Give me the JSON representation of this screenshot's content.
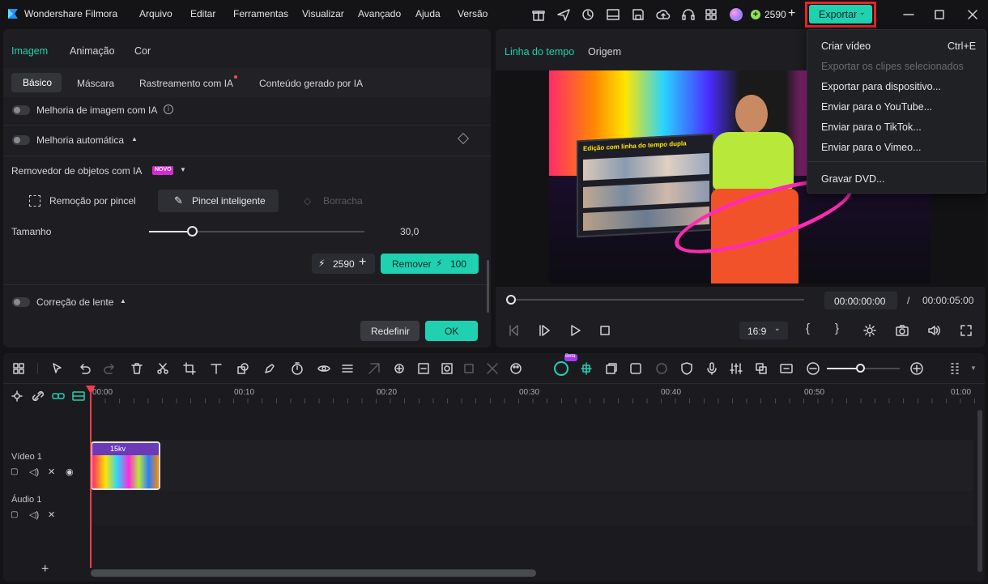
{
  "app": {
    "title": "Wondershare Filmora"
  },
  "menu": [
    "Arquivo",
    "Editar",
    "Ferramentas",
    "Visualizar",
    "Avançado",
    "Ajuda",
    "Versão"
  ],
  "credits": "2590",
  "export_button": "Exportar",
  "export_menu": {
    "items": [
      {
        "label": "Criar vídeo",
        "shortcut": "Ctrl+E",
        "enabled": true
      },
      {
        "label": "Exportar os clipes selecionados",
        "shortcut": "",
        "enabled": false
      },
      {
        "label": "Exportar para dispositivo...",
        "shortcut": "",
        "enabled": true
      },
      {
        "label": "Enviar para o YouTube...",
        "shortcut": "",
        "enabled": true
      },
      {
        "label": "Enviar para o TikTok...",
        "shortcut": "",
        "enabled": true
      },
      {
        "label": "Enviar para o Vimeo...",
        "shortcut": "",
        "enabled": true
      },
      {
        "label": "Gravar DVD...",
        "shortcut": "",
        "enabled": true
      }
    ]
  },
  "left_panel": {
    "tabs": [
      "Imagem",
      "Animação",
      "Cor"
    ],
    "active_tab": "Imagem",
    "subtabs": [
      "Básico",
      "Máscara",
      "Rastreamento com IA",
      "Conteúdo gerado por IA"
    ],
    "active_subtab": "Básico",
    "ai_enhance": "Melhoria de imagem com IA",
    "auto_enhance": "Melhoria automática",
    "object_remover": "Removedor de objetos com IA",
    "new_badge": "NOVO",
    "brush_remove": "Remoção por pincel",
    "smart_brush": "Pincel inteligente",
    "eraser": "Borracha",
    "size_label": "Tamanho",
    "size_value": "30,0",
    "size_fraction": 0.2,
    "credits": "2590",
    "remove_button": "Remover",
    "remove_cost": "100",
    "lens_correction": "Correção de lente",
    "reset_button": "Redefinir",
    "ok_button": "OK"
  },
  "preview": {
    "tabs": [
      "Linha do tempo",
      "Origem"
    ],
    "active_tab": "Linha do tempo",
    "current_time": "00:00:00:00",
    "separator": "/",
    "total_time": "00:00:05:00",
    "aspect": "16:9",
    "video_overlay_text": "Edição com linha do tempo dupla"
  },
  "timeline": {
    "ruler": [
      "00:00",
      "00:10",
      "00:20",
      "00:30",
      "00:40",
      "00:50",
      "01:00"
    ],
    "tracks": [
      {
        "name": "Vídeo 1"
      },
      {
        "name": "Áudio 1"
      }
    ],
    "clip_label": "15kv",
    "new_badge": "Beta"
  },
  "colors": {
    "accent": "#1fd1b0",
    "highlight_red": "#e8232a",
    "new_badge": "#d62bd1"
  }
}
